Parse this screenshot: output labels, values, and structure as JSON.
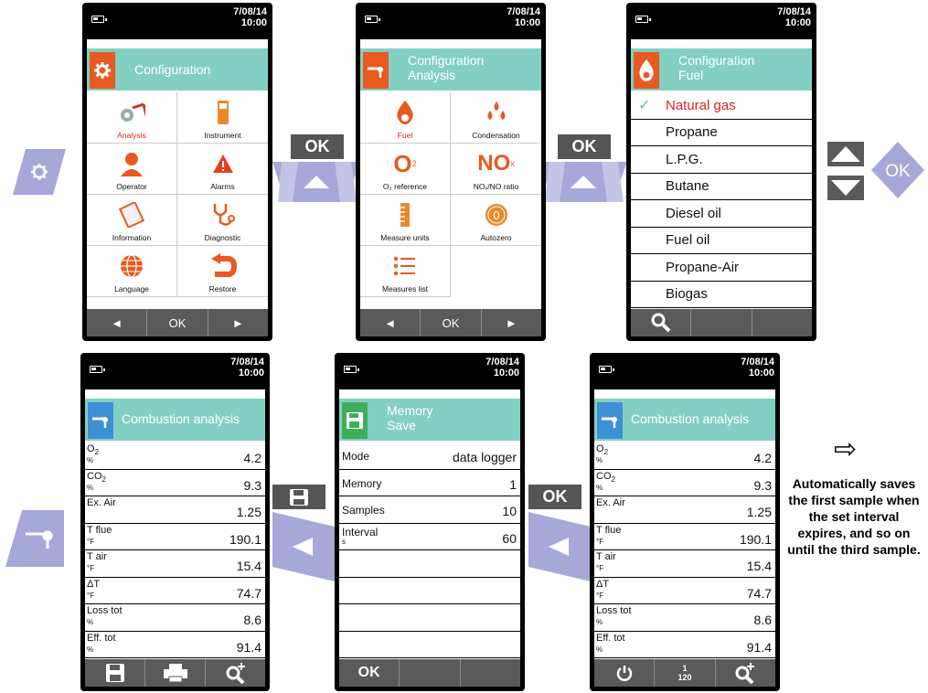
{
  "status": {
    "date": "7/08/14",
    "time": "10:00"
  },
  "colors": {
    "teal": "#83cfc3",
    "accent_orange": "#e85a20",
    "accent_blue": "#3d8fd6",
    "accent_green": "#3fae5a",
    "red": "#d6261e",
    "lavender": "#a6a8d8",
    "footer": "#5a5a5a"
  },
  "screen1": {
    "header": "Configuration",
    "icon": "gear-icon",
    "items": [
      {
        "label": "Analysis",
        "icon": "analysis-icon"
      },
      {
        "label": "Instrument",
        "icon": "instrument-icon"
      },
      {
        "label": "Operator",
        "icon": "operator-icon"
      },
      {
        "label": "Alarms",
        "icon": "alarm-icon"
      },
      {
        "label": "Information",
        "icon": "information-icon"
      },
      {
        "label": "Diagnostic",
        "icon": "stethoscope-icon"
      },
      {
        "label": "Language",
        "icon": "globe-icon"
      },
      {
        "label": "Restore",
        "icon": "restore-icon"
      }
    ],
    "footer": [
      "◄",
      "OK",
      "►"
    ]
  },
  "screen2": {
    "header1": "Configuration",
    "header2": "Analysis",
    "icon": "probe-icon",
    "items": [
      {
        "label": "Fuel",
        "icon": "flame-icon"
      },
      {
        "label": "Condensation",
        "icon": "droplets-icon"
      },
      {
        "label": "O₂ reference",
        "icon": "o2-icon",
        "glyph": "O",
        "sub": "2"
      },
      {
        "label": "NOₓ/NO ratio",
        "icon": "nox-icon",
        "glyph": "NO",
        "sub": "x"
      },
      {
        "label": "Measure units",
        "icon": "ruler-icon"
      },
      {
        "label": "Autozero",
        "icon": "autozero-icon",
        "glyph": "0"
      },
      {
        "label": "Measures list",
        "icon": "list-icon"
      }
    ],
    "footer": [
      "◄",
      "OK",
      "►"
    ]
  },
  "screen3": {
    "header1": "Configuration",
    "header2": "Fuel",
    "icon": "flame-icon",
    "check": "✓",
    "fuels": [
      "Natural gas",
      "Propane",
      "L.P.G.",
      "Butane",
      "Diesel oil",
      "Fuel oil",
      "Propane-Air",
      "Biogas"
    ],
    "footer_icon": "search-icon"
  },
  "screen4": {
    "header": "Combustion analysis",
    "icon": "probe-icon",
    "rows": [
      {
        "name": "O",
        "sub": "2",
        "unit": "%",
        "value": "4.2"
      },
      {
        "name": "CO",
        "sub": "2",
        "unit": "%",
        "value": "9.3"
      },
      {
        "name": "Ex. Air",
        "sub": "",
        "unit": "",
        "value": "1.25"
      },
      {
        "name": "T flue",
        "sub": "",
        "unit": "°F",
        "value": "190.1"
      },
      {
        "name": "T air",
        "sub": "",
        "unit": "°F",
        "value": "15.4"
      },
      {
        "name": "ΔT",
        "sub": "",
        "unit": "°F",
        "value": "74.7"
      },
      {
        "name": "Loss tot",
        "sub": "",
        "unit": "%",
        "value": "8.6"
      },
      {
        "name": "Eff. tot",
        "sub": "",
        "unit": "%",
        "value": "91.4"
      }
    ],
    "footer_icons": [
      "save-icon",
      "printer-icon",
      "zoom-icon"
    ]
  },
  "screen5": {
    "header1": "Memory",
    "header2": "Save",
    "icon": "save-icon",
    "rows": [
      {
        "name": "Mode",
        "unit": "",
        "value": "data logger"
      },
      {
        "name": "Memory",
        "unit": "",
        "value": "1"
      },
      {
        "name": "Samples",
        "unit": "",
        "value": "10"
      },
      {
        "name": "Interval",
        "unit": "s",
        "value": "60"
      }
    ],
    "footer": [
      "OK",
      "",
      ""
    ]
  },
  "screen6": {
    "header": "Combustion analysis",
    "icon": "probe-icon",
    "rows": [
      {
        "name": "O",
        "sub": "2",
        "unit": "%",
        "value": "4.2"
      },
      {
        "name": "CO",
        "sub": "2",
        "unit": "%",
        "value": "9.3"
      },
      {
        "name": "Ex. Air",
        "sub": "",
        "unit": "",
        "value": "1.25"
      },
      {
        "name": "T flue",
        "sub": "",
        "unit": "°F",
        "value": "190.1"
      },
      {
        "name": "T air",
        "sub": "",
        "unit": "°F",
        "value": "15.4"
      },
      {
        "name": "ΔT",
        "sub": "",
        "unit": "°F",
        "value": "74.7"
      },
      {
        "name": "Loss tot",
        "sub": "",
        "unit": "%",
        "value": "8.6"
      },
      {
        "name": "Eff. tot",
        "sub": "",
        "unit": "%",
        "value": "91.4"
      }
    ],
    "footer_counter_top": "1",
    "footer_counter_bottom": "120"
  },
  "keys": {
    "ok": "OK",
    "ok_outline": "OK"
  },
  "note": {
    "arrow": "⇨",
    "text": "Automatically saves the first sample when the set interval expires, and so on until the third sample."
  }
}
